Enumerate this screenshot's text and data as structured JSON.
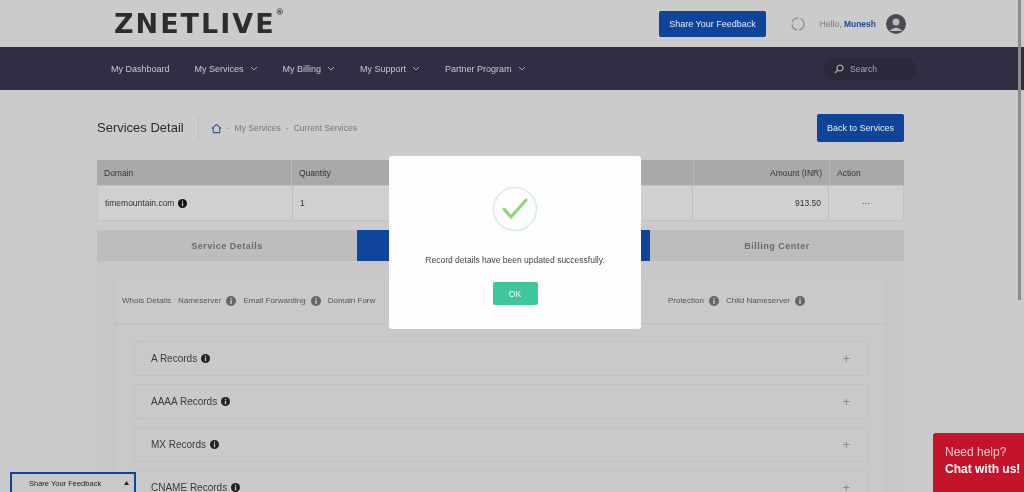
{
  "header": {
    "logo": "ZNETLIVE$^{®}$",
    "feedback_button": "Share Your Feedback",
    "greeting": "Hello,",
    "user": "Munesh"
  },
  "nav": {
    "items": [
      {
        "label": "My Dashboard",
        "dropdown": false
      },
      {
        "label": "My Services",
        "dropdown": true
      },
      {
        "label": "My Billing",
        "dropdown": true
      },
      {
        "label": "My Support",
        "dropdown": true
      },
      {
        "label": "Partner Program",
        "dropdown": true
      }
    ],
    "search": {
      "placeholder": "Search"
    }
  },
  "page": {
    "title": "Services Detail",
    "breadcrumb": [
      {
        "kind": "separator",
        "text": "-"
      },
      {
        "kind": "link",
        "text": "My Services"
      },
      {
        "kind": "separator",
        "text": "-"
      },
      {
        "kind": "link",
        "text": "Current Services"
      }
    ],
    "back_button": "Back to Services"
  },
  "table": {
    "columns": [
      {
        "label": "Domain"
      },
      {
        "label": "Quantity"
      },
      {},
      {
        "label": "Amount (INR)"
      },
      {
        "label": "Action"
      }
    ],
    "rows": [
      {
        "cells": [
          "timemountain.com",
          "1",
          "",
          "913.50",
          "···"
        ],
        "info": true
      }
    ]
  },
  "tabs": [
    {
      "label": "Service Details",
      "selected": false
    },
    {
      "selected": true
    },
    {
      "label": "Billing Center",
      "selected": false
    }
  ],
  "subtabs": [
    {
      "label": "Whois Details",
      "info": false
    },
    {
      "label": "Nameserver",
      "info": true
    },
    {
      "label": "Email Forwarding",
      "info": true
    },
    {
      "label": "Domain Forw",
      "info": false
    },
    {
      "label": "Protection",
      "info": true
    },
    {
      "label": "Child Nameserver",
      "info": true
    }
  ],
  "records": [
    {
      "label": "A Records",
      "expand": "+"
    },
    {
      "label": "AAAA Records",
      "expand": "+"
    },
    {
      "label": "MX Records",
      "expand": "+"
    },
    {
      "label": "CNAME Records",
      "expand": "+"
    }
  ],
  "modal": {
    "message": "Record details have been updated successfully.",
    "ok_button": "OK"
  },
  "feedback_tab": {
    "label": "Share Your Feedback"
  },
  "chat": {
    "line1": "Need help?",
    "line2": "Chat with us!"
  }
}
